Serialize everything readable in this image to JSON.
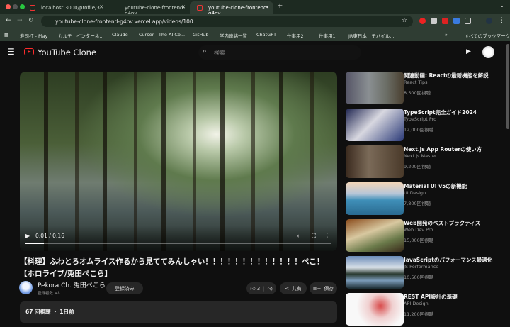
{
  "browser": {
    "tabs": [
      {
        "label": "localhost:3000/profile/3"
      },
      {
        "label": "youtube-clone-frontend-g4pv"
      },
      {
        "label": "youtube-clone-frontend-g4pv"
      }
    ],
    "url": "youtube-clone-frontend-g4pv.vercel.app/videos/100",
    "bookmarks": [
      "寿司打 - Play",
      "カルテ | インターネ...",
      "Claude",
      "Cursor - The AI Co...",
      "GitHub",
      "学内連絡一覧",
      "ChatGPT",
      "仕事用2",
      "仕事用1",
      "JR東日本：モバイル..."
    ],
    "all_bookmarks": "すべてのブックマーク"
  },
  "header": {
    "app_name": "YouTube Clone",
    "search_placeholder": "検索"
  },
  "player": {
    "time": "0:01 / 0:16",
    "progress": 0.06
  },
  "video": {
    "title": "【料理】ふわとろオムライス作るから見ててみんしゃい！！！！！！！！！！！！！ぺこ！【ホロライブ/兎田ぺこら】",
    "channel": "Pekora Ch. 兎田ぺこら",
    "subscribers": "登録者数 4人",
    "subscribe_label": "登録済み",
    "likes": "3",
    "share_label": "共有",
    "save_label": "保存",
    "stats": "67 回視聴 ・ 1日前"
  },
  "related": [
    {
      "title": "関連動画: Reactの最新機能を解説",
      "channel": "React Tips",
      "views": "8,500回視聴"
    },
    {
      "title": "TypeScript完全ガイド2024",
      "channel": "TypeScript Pro",
      "views": "12,000回視聴"
    },
    {
      "title": "Next.js App Routerの使い方",
      "channel": "Next.js Master",
      "views": "9,200回視聴"
    },
    {
      "title": "Material UI v5の新機能",
      "channel": "UI Design",
      "views": "7,800回視聴"
    },
    {
      "title": "Web開発のベストプラクティス",
      "channel": "Web Dev Pro",
      "views": "15,000回視聴"
    },
    {
      "title": "JavaScriptのパフォーマンス最適化",
      "channel": "JS Performance",
      "views": "10,500回視聴"
    },
    {
      "title": "REST API設計の基礎",
      "channel": "API Design",
      "views": "11,200回視聴"
    }
  ]
}
